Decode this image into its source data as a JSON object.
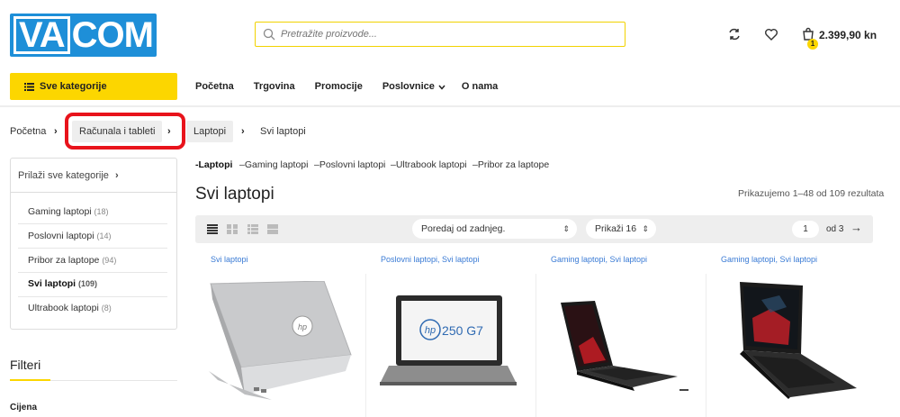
{
  "header": {
    "logo_text_left": "VA",
    "logo_text_right": "COM",
    "search_placeholder": "Pretražite proizvode...",
    "cart_total": "2.399,90 kn",
    "cart_count": "1"
  },
  "nav": {
    "all_categories": "Sve kategorije",
    "items": [
      "Početna",
      "Trgovina",
      "Promocije",
      "Poslovnice",
      "O nama"
    ]
  },
  "breadcrumb": [
    "Početna",
    "Računala i tableti",
    "Laptopi",
    "Svi laptopi"
  ],
  "sidebar": {
    "browse_all": "Prilaži sve kategorije",
    "items": [
      {
        "label": "Gaming laptopi",
        "count": "(18)"
      },
      {
        "label": "Poslovni laptopi",
        "count": "(14)"
      },
      {
        "label": "Pribor za laptope",
        "count": "(94)"
      },
      {
        "label": "Svi laptopi",
        "count": "(109)"
      },
      {
        "label": "Ultrabook laptopi",
        "count": "(8)"
      }
    ],
    "filters_title": "Filteri",
    "price_title": "Cijena"
  },
  "subcategories": [
    "-Laptopi",
    "–Gaming laptopi",
    "–Poslovni laptopi",
    "–Ultrabook laptopi",
    "–Pribor za laptope"
  ],
  "main": {
    "title": "Svi laptopi",
    "results": "Prikazujemo 1–48 od 109 rezultata"
  },
  "toolbar": {
    "sort": "Poredaj od zadnjeg.",
    "per_page": "Prikaži 16",
    "page": "1",
    "of_pages": "od 3"
  },
  "products": [
    {
      "category": "Svi laptopi"
    },
    {
      "category": "Poslovni laptopi, Svi laptopi",
      "screen_text": "250 G7"
    },
    {
      "category": "Gaming laptopi, Svi laptopi"
    },
    {
      "category": "Gaming laptopi, Svi laptopi"
    }
  ],
  "colors": {
    "brand_blue": "#1e8fd8",
    "accent_yellow": "#fcd600",
    "highlight_red": "#e8131b"
  }
}
